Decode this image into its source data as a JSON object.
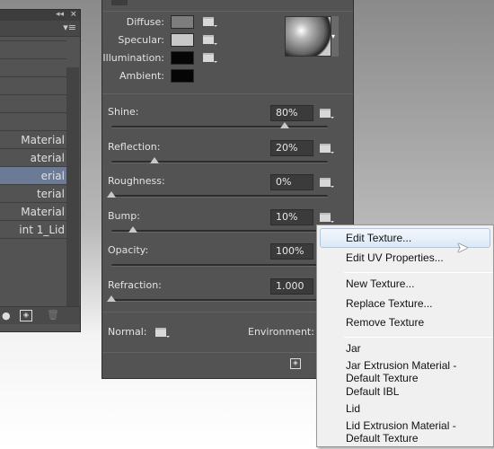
{
  "layers_panel": {
    "rows": [
      "",
      "",
      "",
      "",
      "",
      "",
      " Material",
      "aterial",
      "erial",
      "terial",
      " Material",
      "int 1_Lid"
    ],
    "selected_index": 8
  },
  "properties": {
    "colors": [
      {
        "label": "Diffuse:",
        "color": "#7d7d7d",
        "icon": "texture-icon"
      },
      {
        "label": "Specular:",
        "color": "#c8c8c8",
        "icon": "folder-icon"
      },
      {
        "label": "Illumination:",
        "color": "#050505",
        "icon": "folder-icon"
      },
      {
        "label": "Ambient:",
        "color": "#050505"
      }
    ],
    "sliders": [
      {
        "label": "Shine:",
        "value": "80%",
        "percent": 80
      },
      {
        "label": "Reflection:",
        "value": "20%",
        "percent": 20
      },
      {
        "label": "Roughness:",
        "value": "0%",
        "percent": 0
      },
      {
        "label": "Bump:",
        "value": "10%",
        "percent": 10
      },
      {
        "label": "Opacity:",
        "value": "100%",
        "percent": 100
      },
      {
        "label": "Refraction:",
        "value": "1.000",
        "percent": 0
      }
    ],
    "normal_label": "Normal:",
    "environment_label": "Environment:"
  },
  "context_menu": {
    "group1": [
      "Edit Texture...",
      "Edit UV Properties..."
    ],
    "group2": [
      "New Texture...",
      "Replace Texture...",
      "Remove Texture"
    ],
    "group3": [
      "Jar",
      "Jar Extrusion Material - Default Texture",
      "Default IBL",
      "Lid",
      "Lid Extrusion Material - Default Texture"
    ],
    "highlighted": "Edit Texture..."
  }
}
